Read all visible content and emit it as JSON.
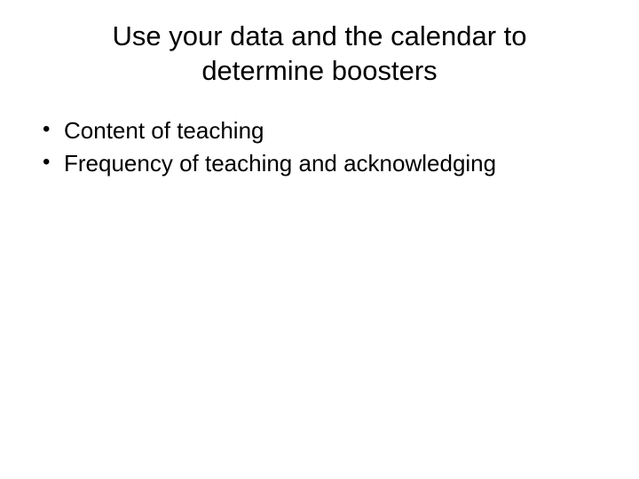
{
  "slide": {
    "title": "Use your data and the calendar to determine boosters",
    "bullets": [
      "Content of teaching",
      "Frequency of teaching and acknowledging"
    ]
  }
}
